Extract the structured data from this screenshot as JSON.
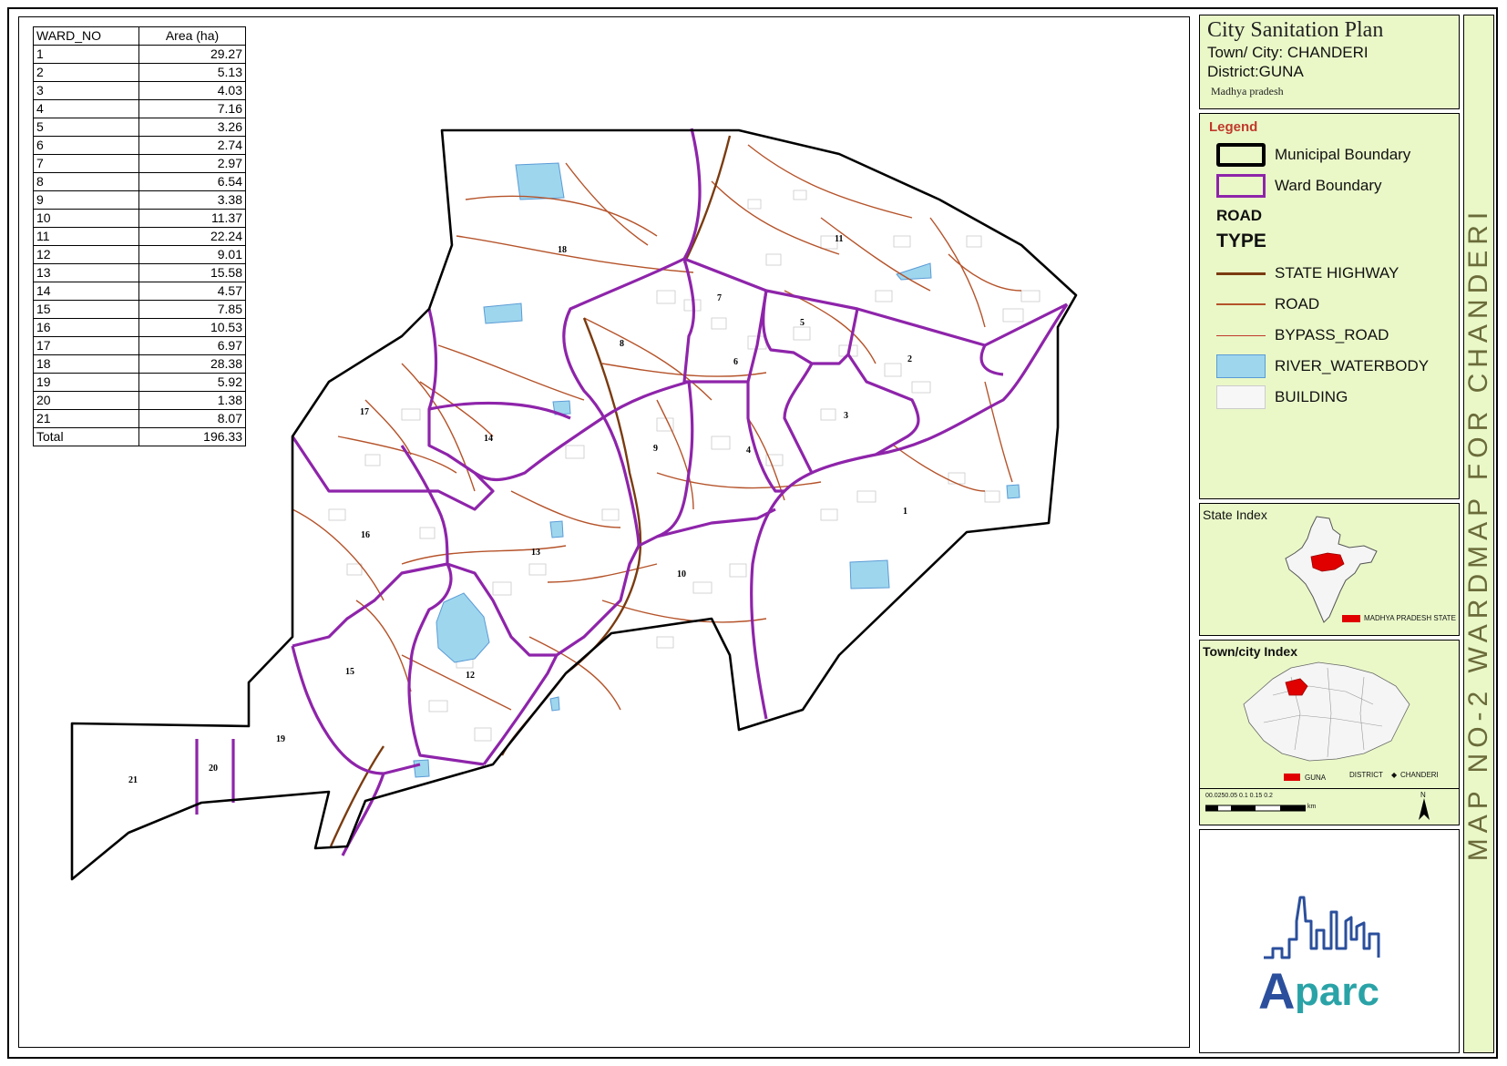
{
  "area_table": {
    "headers": [
      "WARD_NO",
      "Area (ha)"
    ],
    "rows": [
      [
        "1",
        "29.27"
      ],
      [
        "2",
        "5.13"
      ],
      [
        "3",
        "4.03"
      ],
      [
        "4",
        "7.16"
      ],
      [
        "5",
        "3.26"
      ],
      [
        "6",
        "2.74"
      ],
      [
        "7",
        "2.97"
      ],
      [
        "8",
        "6.54"
      ],
      [
        "9",
        "3.38"
      ],
      [
        "10",
        "11.37"
      ],
      [
        "11",
        "22.24"
      ],
      [
        "12",
        "9.01"
      ],
      [
        "13",
        "15.58"
      ],
      [
        "14",
        "4.57"
      ],
      [
        "15",
        "7.85"
      ],
      [
        "16",
        "10.53"
      ],
      [
        "17",
        "6.97"
      ],
      [
        "18",
        "28.38"
      ],
      [
        "19",
        "5.92"
      ],
      [
        "20",
        "1.38"
      ],
      [
        "21",
        "8.07"
      ],
      [
        "Total",
        "196.33"
      ]
    ]
  },
  "title_block": {
    "title": "City Sanitation Plan",
    "town": "Town/ City: CHANDERI",
    "district": "District:GUNA",
    "state": "Madhya pradesh"
  },
  "legend": {
    "title": "Legend",
    "municipal_boundary": "Municipal Boundary",
    "ward_boundary": "Ward Boundary",
    "road_heading": "ROAD",
    "type_heading": "TYPE",
    "state_highway": "STATE HIGHWAY",
    "road": "ROAD",
    "bypass_road": "BYPASS_ROAD",
    "river_waterbody": "RIVER_WATERBODY",
    "building": "BUILDING"
  },
  "state_index": {
    "label": "State Index",
    "caption": "MADHYA PRADESH STATE"
  },
  "town_index": {
    "label": "Town/city Index",
    "guna": "GUNA",
    "district": "DISTRICT",
    "chanderi": "CHANDERI"
  },
  "scale_bar": {
    "ticks": "00.0250.05   0.1   0.15   0.2",
    "unit": "km",
    "north": "N"
  },
  "logo_text": {
    "first": "A",
    "rest": "parc"
  },
  "vertical_title": "MAP NO-2 WARDMAP FOR CHANDERI",
  "ward_labels": [
    {
      "id": "1",
      "label": "1"
    },
    {
      "id": "2",
      "label": "2"
    },
    {
      "id": "3",
      "label": "3"
    },
    {
      "id": "4",
      "label": "4"
    },
    {
      "id": "5",
      "label": "5"
    },
    {
      "id": "6",
      "label": "6"
    },
    {
      "id": "7",
      "label": "7"
    },
    {
      "id": "8",
      "label": "8"
    },
    {
      "id": "9",
      "label": "9"
    },
    {
      "id": "10",
      "label": "10"
    },
    {
      "id": "11",
      "label": "11"
    },
    {
      "id": "12",
      "label": "12"
    },
    {
      "id": "13",
      "label": "13"
    },
    {
      "id": "14",
      "label": "14"
    },
    {
      "id": "15",
      "label": "15"
    },
    {
      "id": "16",
      "label": "16"
    },
    {
      "id": "17",
      "label": "17"
    },
    {
      "id": "18",
      "label": "18"
    },
    {
      "id": "19",
      "label": "19"
    },
    {
      "id": "20",
      "label": "20"
    },
    {
      "id": "21",
      "label": "21"
    }
  ],
  "colors": {
    "ward_boundary": "#8e24aa",
    "road": "#b5532a",
    "state_highway": "#7a3b10",
    "waterbody": "#9ed6ee",
    "panel_bg": "#eaf8c8",
    "index_highlight": "#e00000"
  }
}
